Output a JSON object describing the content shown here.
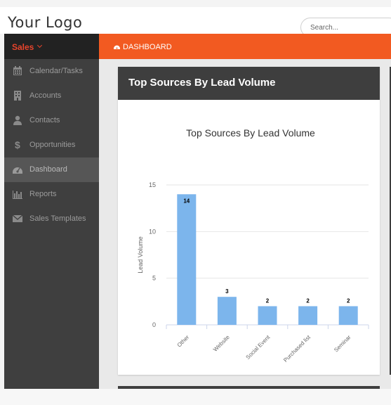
{
  "header": {
    "logo": "Your Logo",
    "search_placeholder": "Search..."
  },
  "sidebar": {
    "title": "Sales",
    "items": [
      {
        "label": "Calendar/Tasks",
        "icon": "calendar-icon"
      },
      {
        "label": "Accounts",
        "icon": "building-icon"
      },
      {
        "label": "Contacts",
        "icon": "user-icon"
      },
      {
        "label": "Opportunities",
        "icon": "dollar-icon"
      },
      {
        "label": "Dashboard",
        "icon": "dashboard-icon",
        "active": true
      },
      {
        "label": "Reports",
        "icon": "bar-chart-icon"
      },
      {
        "label": "Sales Templates",
        "icon": "envelope-icon"
      }
    ]
  },
  "breadcrumb": {
    "label": "DASHBOARD"
  },
  "panel": {
    "title": "Top Sources By Lead Volume"
  },
  "colors": {
    "accent": "#f25a21",
    "bar": "#7cb5ec",
    "sidebar": "#3f3f3f"
  },
  "chart_data": {
    "type": "bar",
    "title": "Top Sources By Lead Volume",
    "xlabel": "",
    "ylabel": "Lead Volume",
    "categories": [
      "Other",
      "Website",
      "Social Event",
      "Purchased list",
      "Seminar"
    ],
    "values": [
      14,
      3,
      2,
      2,
      2
    ],
    "ylim": [
      0,
      15
    ],
    "yticks": [
      0,
      5,
      10,
      15
    ],
    "grid": true,
    "data_labels": true
  }
}
